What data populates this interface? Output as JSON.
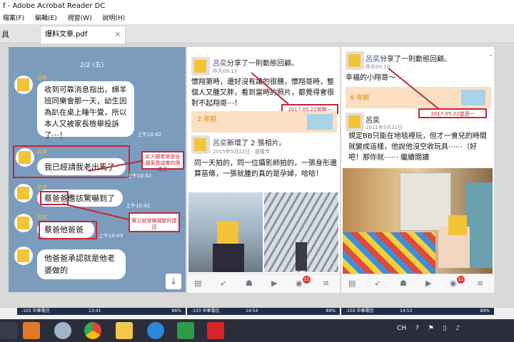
{
  "window": {
    "title": "f - Adobe Acrobat Reader DC"
  },
  "menu": [
    "檔案(F)",
    "編輯(E)",
    "視窗(W)",
    "說明(H)"
  ],
  "tool_label": "具",
  "doc_tab": {
    "label": "爆料文章.pdf",
    "close": "×"
  },
  "chat": {
    "date": "2/2 (五)",
    "messages": [
      {
        "name": "呂奕",
        "text": "收到可靠消息指出，綿羊班同樂會那一天，幼生因為趴在桌上睡午覺，所以本人又被家長檢舉投訴了⋯！",
        "time": "上午10:42"
      },
      {
        "name": "呂奕",
        "text": "我已經請我老出馬了",
        "time": "上午10:42"
      },
      {
        "name": "呂奕",
        "text": "蔡爸爸應該驚嚇到了",
        "time": "上午10:42"
      },
      {
        "name": "呂奕",
        "text": "蔡爸他爸爸",
        "time": "上午10:43"
      },
      {
        "name": "呂奕",
        "text": "他爸爸承認就是他老婆做的",
        "time": ""
      }
    ],
    "note1": "此人跟老爸是全國家長協會的理事長",
    "note2": "蔡公就是楊福鞋的頭目",
    "scroll_down": "↓"
  },
  "fb_mid": {
    "name": "呂奕",
    "action": "分享了一則動態回顧。",
    "time": "昨天09:13",
    "text": "懷翔第時，還好沒有讓的很胰，懷翔哥時，整個人又腫又胖，看到當時的照片，都覺得會很對不起翔哥⋯！",
    "ann": "2017.05.22當期一",
    "years": "2 年前",
    "inner_name": "呂奕",
    "inner_action": "新增了 2 張相片。",
    "inner_time": "2015年5月22日 · 基隆市",
    "inner_text": "同一天拍的，同一位攝影師拍的，一張身形還算苗條，一張就腫的真的是孕婦，哈哈！"
  },
  "fb_right": {
    "name": "呂奕",
    "action": "分享了一則動態回顧。",
    "time": "昨天09:10",
    "text": "幸福的小翔哥～",
    "ann": "2017.05.22當週一",
    "years": "6 年前",
    "inner_name": "呂奕",
    "inner_time": "2011年5月22日",
    "inner_text": "規定BB只能在地毯裡玩，但才一會兒的時間就變成這樣，他說他沒空收玩具⋯⋯（好吧！那你就⋯⋯ 繼續閱讀"
  },
  "badge": "11",
  "status": {
    "carrier": "-103 中華電信",
    "time1": "13:41",
    "batt1": "86%",
    "time2": "14:54",
    "batt2": "89%",
    "time3": "14:53"
  },
  "tray": {
    "lang": "CH"
  },
  "colors": {
    "chat_bg": "#7c9cbe",
    "annotation_red": "#c2273a",
    "fb_blue": "#4a6da8",
    "avatar_yellow": "#f3c437"
  }
}
